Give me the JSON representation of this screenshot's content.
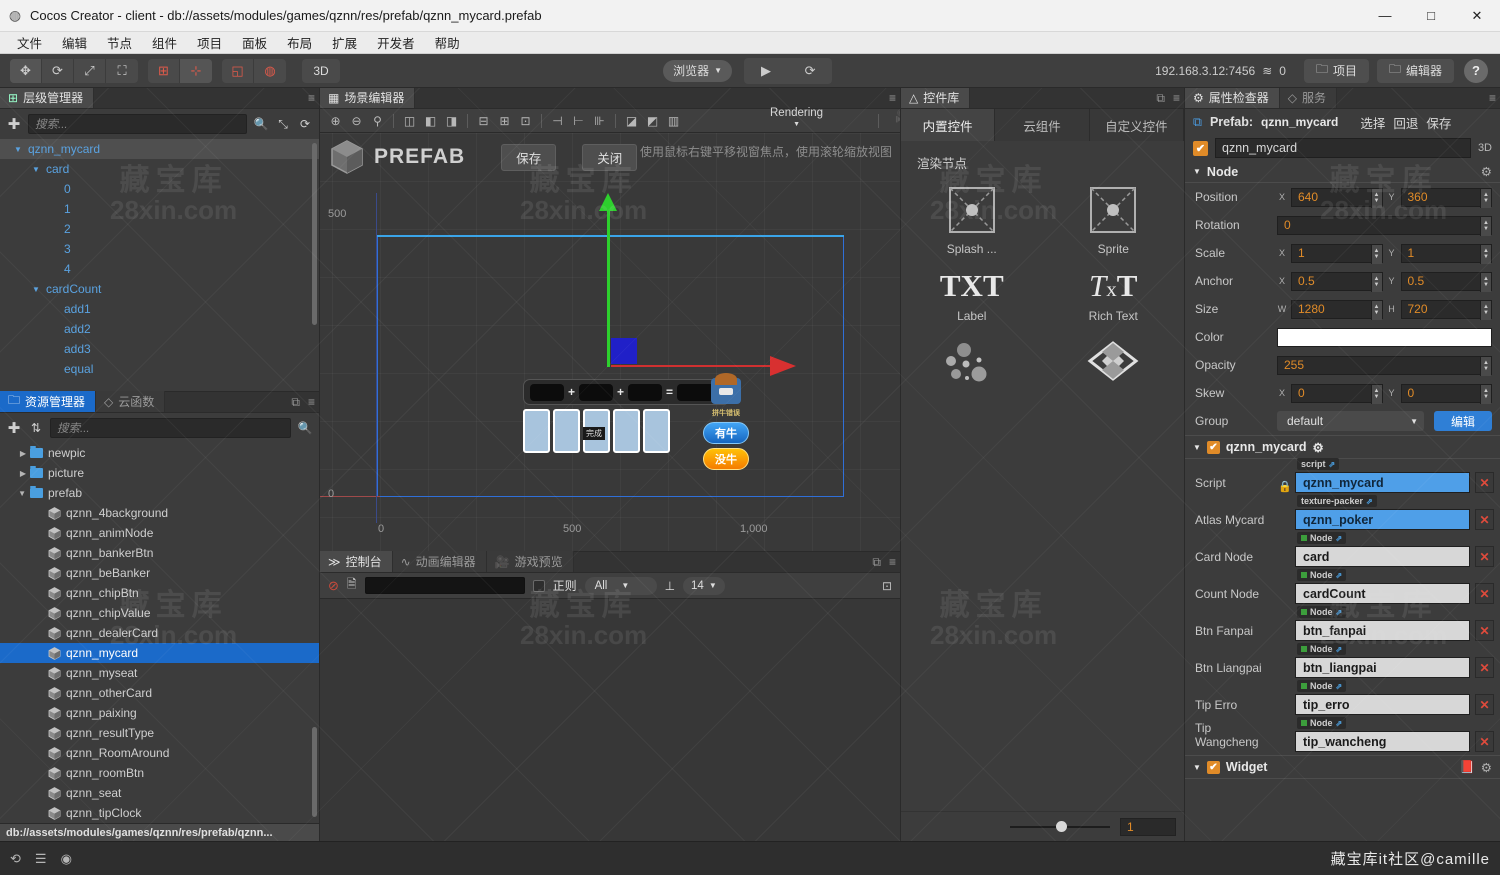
{
  "window": {
    "title": "Cocos Creator - client - db://assets/modules/games/qznn/res/prefab/qznn_mycard.prefab",
    "app_icon": "cocos-logo-icon",
    "minimize": "—",
    "maximize": "□",
    "close": "✕"
  },
  "menubar": {
    "items": [
      "文件",
      "编辑",
      "节点",
      "组件",
      "项目",
      "面板",
      "布局",
      "扩展",
      "开发者",
      "帮助"
    ]
  },
  "toolbar": {
    "transform_tools": [
      {
        "name": "move-tool",
        "glyph": "✥"
      },
      {
        "name": "rotate-tool",
        "glyph": "⟳"
      },
      {
        "name": "scale-tool",
        "glyph": "⤢"
      },
      {
        "name": "rect-tool",
        "glyph": "⛶"
      }
    ],
    "align_tools": [
      {
        "name": "pivot-tool",
        "glyph": "⊞"
      },
      {
        "name": "coord-tool",
        "glyph": "⊹"
      }
    ],
    "snap_tools": [
      {
        "name": "local-space-tool",
        "glyph": "◱"
      },
      {
        "name": "global-space-tool",
        "glyph": "◍"
      }
    ],
    "mode_3d": "3D",
    "preview_target": "浏览器",
    "play_icon": "play-icon",
    "refresh_icon": "refresh-icon",
    "device_address": "192.168.3.12:7456",
    "wifi_icon": "wifi-icon",
    "device_count": "0",
    "project_button": "项目",
    "editor_button": "编辑器",
    "help_button": "?"
  },
  "hierarchy": {
    "tab_label": "层级管理器",
    "tab_icon": "hierarchy-icon",
    "menu_icon": "hamburger-icon",
    "add_icon": "plus-icon",
    "search_placeholder": "搜索...",
    "search_icon": "search-icon",
    "collapse_icon": "collapse-icon",
    "refresh_icon": "refresh-icon",
    "nodes": [
      {
        "label": "qznn_mycard",
        "depth": 0,
        "expanded": true,
        "selected": true
      },
      {
        "label": "card",
        "depth": 1,
        "expanded": true,
        "selected": false
      },
      {
        "label": "0",
        "depth": 2,
        "expanded": null,
        "selected": false
      },
      {
        "label": "1",
        "depth": 2,
        "expanded": null,
        "selected": false
      },
      {
        "label": "2",
        "depth": 2,
        "expanded": null,
        "selected": false
      },
      {
        "label": "3",
        "depth": 2,
        "expanded": null,
        "selected": false
      },
      {
        "label": "4",
        "depth": 2,
        "expanded": null,
        "selected": false
      },
      {
        "label": "cardCount",
        "depth": 1,
        "expanded": true,
        "selected": false
      },
      {
        "label": "add1",
        "depth": 2,
        "expanded": null,
        "selected": false
      },
      {
        "label": "add2",
        "depth": 2,
        "expanded": null,
        "selected": false
      },
      {
        "label": "add3",
        "depth": 2,
        "expanded": null,
        "selected": false
      },
      {
        "label": "equal",
        "depth": 2,
        "expanded": null,
        "selected": false
      }
    ]
  },
  "assets": {
    "tabs": [
      {
        "label": "资源管理器",
        "icon": "folder-icon",
        "active": true
      },
      {
        "label": "云函数",
        "icon": "cloud-icon",
        "active": false
      }
    ],
    "popout_icon": "popout-icon",
    "menu_icon": "hamburger-icon",
    "add_icon": "plus-icon",
    "sort_icon": "sort-icon",
    "search_placeholder": "搜索...",
    "search_icon": "search-icon",
    "items": [
      {
        "label": "newpic",
        "type": "folder",
        "depth": 1,
        "expanded": false
      },
      {
        "label": "picture",
        "type": "folder",
        "depth": 1,
        "expanded": false
      },
      {
        "label": "prefab",
        "type": "folder",
        "depth": 1,
        "expanded": true
      },
      {
        "label": "qznn_4background",
        "type": "prefab",
        "depth": 2
      },
      {
        "label": "qznn_animNode",
        "type": "prefab",
        "depth": 2
      },
      {
        "label": "qznn_bankerBtn",
        "type": "prefab",
        "depth": 2
      },
      {
        "label": "qznn_beBanker",
        "type": "prefab",
        "depth": 2
      },
      {
        "label": "qznn_chipBtn",
        "type": "prefab",
        "depth": 2
      },
      {
        "label": "qznn_chipValue",
        "type": "prefab",
        "depth": 2
      },
      {
        "label": "qznn_dealerCard",
        "type": "prefab",
        "depth": 2
      },
      {
        "label": "qznn_mycard",
        "type": "prefab",
        "depth": 2,
        "selected": true
      },
      {
        "label": "qznn_myseat",
        "type": "prefab",
        "depth": 2
      },
      {
        "label": "qznn_otherCard",
        "type": "prefab",
        "depth": 2
      },
      {
        "label": "qznn_paixing",
        "type": "prefab",
        "depth": 2
      },
      {
        "label": "qznn_resultType",
        "type": "prefab",
        "depth": 2
      },
      {
        "label": "qznn_RoomAround",
        "type": "prefab",
        "depth": 2
      },
      {
        "label": "qznn_roomBtn",
        "type": "prefab",
        "depth": 2
      },
      {
        "label": "qznn_seat",
        "type": "prefab",
        "depth": 2
      },
      {
        "label": "qznn_tipClock",
        "type": "prefab",
        "depth": 2
      }
    ],
    "status_path": "db://assets/modules/games/qznn/res/prefab/qznn..."
  },
  "scene": {
    "tab_label": "场景编辑器",
    "tab_icon": "scene-icon",
    "menu_icon": "hamburger-icon",
    "tools": [
      {
        "name": "zoom-in-icon",
        "glyph": "⊕"
      },
      {
        "name": "zoom-out-icon",
        "glyph": "⊖"
      },
      {
        "name": "zoom-fit-icon",
        "glyph": "⚲"
      },
      {
        "name": "align-left-icon",
        "glyph": "◫"
      },
      {
        "name": "align-center-h-icon",
        "glyph": "◧"
      },
      {
        "name": "align-right-icon",
        "glyph": "◨"
      },
      {
        "name": "align-top-icon",
        "glyph": "⊟"
      },
      {
        "name": "align-middle-v-icon",
        "glyph": "⊞"
      },
      {
        "name": "align-bottom-icon",
        "glyph": "⊡"
      },
      {
        "name": "distribute-h-icon",
        "glyph": "⊣"
      },
      {
        "name": "distribute-v-icon",
        "glyph": "⊢"
      },
      {
        "name": "distribute-even-icon",
        "glyph": "⊪"
      },
      {
        "name": "spacing-h-icon",
        "glyph": "◪"
      },
      {
        "name": "spacing-v-icon",
        "glyph": "◩"
      },
      {
        "name": "spacing-even-icon",
        "glyph": "▥"
      }
    ],
    "rendering_label": "Rendering",
    "camera_icon": "camera-icon",
    "prefab_badge": "PREFAB",
    "prefab_icon": "prefab-cube-icon",
    "save_button": "保存",
    "close_button": "关闭",
    "hint": "使用鼠标右键平移视窗焦点，使用滚轮缩放视图",
    "ruler_y_labels": [
      "500",
      "0"
    ],
    "ruler_x_labels": [
      "0",
      "500",
      "1,000"
    ],
    "game_mock": {
      "operators": [
        "+",
        "+",
        "="
      ],
      "card_label": "完成",
      "avatar_label": "拼牛错误",
      "btn_you_niu": "有牛",
      "btn_mei_niu": "没牛"
    }
  },
  "console": {
    "tabs": [
      {
        "label": "控制台",
        "icon": "console-icon",
        "active": true
      },
      {
        "label": "动画编辑器",
        "icon": "anim-icon",
        "active": false
      },
      {
        "label": "游戏预览",
        "icon": "preview-icon",
        "active": false
      }
    ],
    "popout_icon": "popout-icon",
    "menu_icon": "hamburger-icon",
    "clear_icon": "clear-icon",
    "file_icon": "file-icon",
    "filter_value": "",
    "regex_label": "正则",
    "level_select": "All",
    "font_icon": "font-size-icon",
    "font_size": "14",
    "expand_icon": "expand-icon"
  },
  "widget_library": {
    "tab_label": "控件库",
    "tab_icon": "triangle-icon",
    "popout_icon": "popout-icon",
    "menu_icon": "hamburger-icon",
    "tabs": [
      {
        "label": "内置控件",
        "active": true
      },
      {
        "label": "云组件",
        "active": false
      },
      {
        "label": "自定义控件",
        "active": false
      }
    ],
    "section_title": "渲染节点",
    "items": [
      {
        "label": "Splash ...",
        "icon": "splash-icon"
      },
      {
        "label": "Sprite",
        "icon": "sprite-icon"
      },
      {
        "label": "Label",
        "icon": "txt-icon"
      },
      {
        "label": "Rich Text",
        "icon": "rich-text-icon"
      },
      {
        "label": "",
        "icon": "particle-icon"
      },
      {
        "label": "",
        "icon": "tiled-map-icon"
      }
    ],
    "zoom_value": "1"
  },
  "inspector": {
    "tabs": [
      {
        "label": "属性检查器",
        "icon": "gear-icon",
        "active": true
      },
      {
        "label": "服务",
        "icon": "service-icon",
        "active": false
      }
    ],
    "menu_icon": "hamburger-icon",
    "prefab_icon": "prefab-link-icon",
    "prefab_label": "Prefab:",
    "prefab_name": "qznn_mycard",
    "prefab_actions": [
      "选择",
      "回退",
      "保存"
    ],
    "node_enabled": true,
    "node_name": "qznn_mycard",
    "mode_3d": "3D",
    "node_section": {
      "title": "Node",
      "gear_icon": "gear-icon",
      "properties": [
        {
          "label": "Position",
          "type": "xy",
          "x": "640",
          "y": "360"
        },
        {
          "label": "Rotation",
          "type": "single",
          "value": "0"
        },
        {
          "label": "Scale",
          "type": "xy",
          "x": "1",
          "y": "1"
        },
        {
          "label": "Anchor",
          "type": "xy",
          "x": "0.5",
          "y": "0.5"
        },
        {
          "label": "Size",
          "type": "wh",
          "w": "1280",
          "h": "720",
          "x_axis": "W",
          "y_axis": "H"
        },
        {
          "label": "Color",
          "type": "color",
          "value": "#ffffff"
        },
        {
          "label": "Opacity",
          "type": "single",
          "value": "255"
        },
        {
          "label": "Skew",
          "type": "xy",
          "x": "0",
          "y": "0"
        },
        {
          "label": "Group",
          "type": "select",
          "value": "default",
          "button": "编辑"
        }
      ]
    },
    "component_section": {
      "title": "qznn_mycard",
      "enabled": true,
      "gear_icon": "gear-icon",
      "properties": [
        {
          "label": "Script",
          "tag": "script",
          "value": "qznn_mycard",
          "style": "blue",
          "locked": true
        },
        {
          "label": "Atlas Mycard",
          "tag": "texture-packer",
          "value": "qznn_poker",
          "style": "blue"
        },
        {
          "label": "Card Node",
          "tag": "Node",
          "value": "card",
          "style": "grey"
        },
        {
          "label": "Count Node",
          "tag": "Node",
          "value": "cardCount",
          "style": "grey"
        },
        {
          "label": "Btn Fanpai",
          "tag": "Node",
          "value": "btn_fanpai",
          "style": "grey"
        },
        {
          "label": "Btn Liangpai",
          "tag": "Node",
          "value": "btn_liangpai",
          "style": "grey"
        },
        {
          "label": "Tip Erro",
          "tag": "Node",
          "value": "tip_erro",
          "style": "grey"
        },
        {
          "label": "Tip Wangcheng",
          "tag": "Node",
          "value": "tip_wancheng",
          "style": "grey"
        }
      ]
    },
    "widget_section": {
      "title": "Widget",
      "enabled": true,
      "help_icon": "book-icon",
      "gear_icon": "gear-icon"
    }
  },
  "bottombar": {
    "icons": [
      {
        "name": "sync-icon",
        "glyph": "⟲"
      },
      {
        "name": "database-icon",
        "glyph": "☰"
      },
      {
        "name": "eye-icon",
        "glyph": "◉"
      }
    ],
    "credit": "藏宝库it社区@camille"
  },
  "watermarks": {
    "line1": "藏宝库",
    "line2": "28xin.com"
  },
  "colors": {
    "accent_orange": "#e08b28",
    "accent_blue": "#1b6ac9",
    "node_blue": "#5aa2e0",
    "ref_blue": "#4f9fe8",
    "delete_red": "#e04b3c"
  }
}
